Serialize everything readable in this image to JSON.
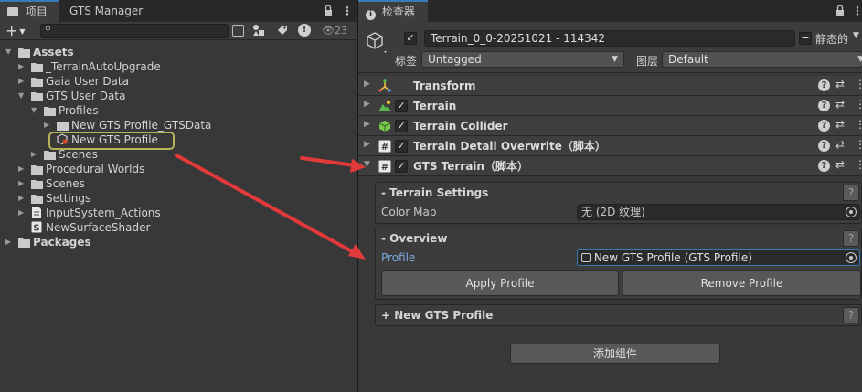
{
  "project_panel": {
    "tabs": [
      "项目",
      "GTS Manager"
    ],
    "toolbar": {
      "add_label": "+",
      "search_placeholder": "",
      "hidden_count": "23"
    },
    "tree": [
      {
        "label": "Assets",
        "depth": 0,
        "expanded": true,
        "bold": true,
        "icon": "folder-icon"
      },
      {
        "label": "_TerrainAutoUpgrade",
        "depth": 1,
        "expanded": false,
        "icon": "folder-icon"
      },
      {
        "label": "Gaia User Data",
        "depth": 1,
        "expanded": false,
        "icon": "folder-icon"
      },
      {
        "label": "GTS User Data",
        "depth": 1,
        "expanded": true,
        "icon": "folder-icon"
      },
      {
        "label": "Profiles",
        "depth": 2,
        "expanded": true,
        "icon": "folder-icon"
      },
      {
        "label": "New GTS Profile_GTSData",
        "depth": 3,
        "expanded": false,
        "icon": "folder-icon"
      },
      {
        "label": "New GTS Profile",
        "depth": 3,
        "expanded": null,
        "icon": "gts-profile-icon",
        "selected": true
      },
      {
        "label": "Scenes",
        "depth": 2,
        "expanded": false,
        "icon": "folder-icon"
      },
      {
        "label": "Procedural Worlds",
        "depth": 1,
        "expanded": false,
        "icon": "folder-icon"
      },
      {
        "label": "Scenes",
        "depth": 1,
        "expanded": false,
        "icon": "folder-icon"
      },
      {
        "label": "Settings",
        "depth": 1,
        "expanded": false,
        "icon": "folder-icon"
      },
      {
        "label": "InputSystem_Actions",
        "depth": 1,
        "expanded": false,
        "icon": "input-actions-icon"
      },
      {
        "label": "NewSurfaceShader",
        "depth": 1,
        "expanded": null,
        "icon": "shader-icon"
      },
      {
        "label": "Packages",
        "depth": 0,
        "expanded": false,
        "bold": true,
        "icon": "folder-icon"
      }
    ]
  },
  "inspector": {
    "tab_label": "检查器",
    "object_name": "Terrain_0_0-20251021 - 114342",
    "static_label": "静态的",
    "tag_label": "标签",
    "tag_value": "Untagged",
    "layer_label": "图层",
    "layer_value": "Default",
    "components": [
      {
        "name": "Transform",
        "has_checkbox": false,
        "icon": "transform-icon"
      },
      {
        "name": "Terrain",
        "has_checkbox": true,
        "icon": "terrain-icon"
      },
      {
        "name": "Terrain Collider",
        "has_checkbox": true,
        "icon": "terrain-collider-icon"
      },
      {
        "name": "Terrain Detail Overwrite（脚本）",
        "has_checkbox": true,
        "icon": "script-icon"
      },
      {
        "name": "GTS Terrain（脚本）",
        "has_checkbox": true,
        "icon": "script-icon",
        "expanded": true
      }
    ],
    "terrain_settings": {
      "title": "- Terrain Settings",
      "color_map_label": "Color Map",
      "color_map_value": "无 (2D 纹理)"
    },
    "overview": {
      "title": "- Overview",
      "profile_label": "Profile",
      "profile_value": "New GTS Profile (GTS Profile)",
      "apply_label": "Apply Profile",
      "remove_label": "Remove Profile"
    },
    "new_profile_section": {
      "title": "+ New GTS Profile"
    },
    "add_component_label": "添加组件"
  },
  "colors": {
    "accent_blue": "#3a79bb",
    "profile_label_blue": "#7fa9e0",
    "highlight_box": "#b7b35a",
    "annotation_arrow": "#e23a3a"
  }
}
